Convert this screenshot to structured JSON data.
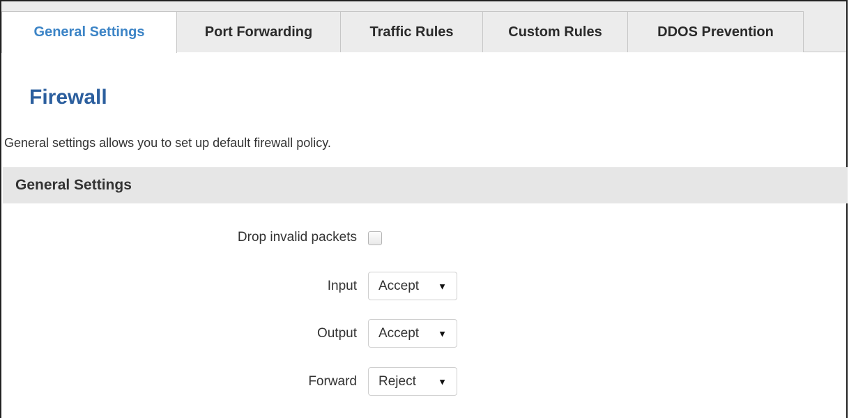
{
  "tabs": [
    {
      "label": "General Settings",
      "active": true
    },
    {
      "label": "Port Forwarding",
      "active": false
    },
    {
      "label": "Traffic Rules",
      "active": false
    },
    {
      "label": "Custom Rules",
      "active": false
    },
    {
      "label": "DDOS Prevention",
      "active": false
    }
  ],
  "page": {
    "title": "Firewall",
    "description": "General settings allows you to set up default firewall policy."
  },
  "section": {
    "title": "General Settings"
  },
  "fields": {
    "drop_invalid": {
      "label": "Drop invalid packets",
      "checked": false
    },
    "input": {
      "label": "Input",
      "value": "Accept"
    },
    "output": {
      "label": "Output",
      "value": "Accept"
    },
    "forward": {
      "label": "Forward",
      "value": "Reject"
    }
  },
  "icons": {
    "dropdown_caret": "▼"
  },
  "colors": {
    "active_tab_text": "#3c84c6",
    "title_text": "#2c5f9e",
    "tabbar_bg": "#ececec",
    "section_bg": "#e6e6e6"
  }
}
